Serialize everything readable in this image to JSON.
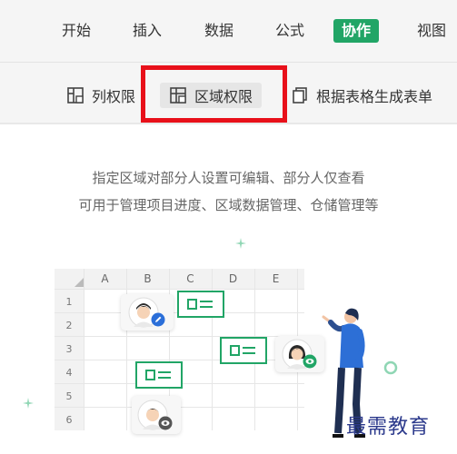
{
  "menu": {
    "items": [
      {
        "label": "开始",
        "active": false
      },
      {
        "label": "插入",
        "active": false
      },
      {
        "label": "数据",
        "active": false
      },
      {
        "label": "公式",
        "active": false
      },
      {
        "label": "协作",
        "active": true
      },
      {
        "label": "视图",
        "active": false
      }
    ]
  },
  "toolbar": {
    "column_permission": "列权限",
    "region_permission": "区域权限",
    "generate_form": "根据表格生成表单"
  },
  "description": {
    "line1": "指定区域对部分人设置可编辑、部分人仅查看",
    "line2": "可用于管理项目进度、区域数据管理、仓储管理等"
  },
  "sheet": {
    "columns": [
      "A",
      "B",
      "C",
      "D",
      "E"
    ],
    "rows": [
      "1",
      "2",
      "3",
      "4",
      "5",
      "6"
    ]
  },
  "watermark": "最需教育",
  "colors": {
    "accent": "#21a566",
    "highlight": "#e8101a",
    "edit_badge": "#2b6fd9",
    "view_badge": "#555555"
  }
}
